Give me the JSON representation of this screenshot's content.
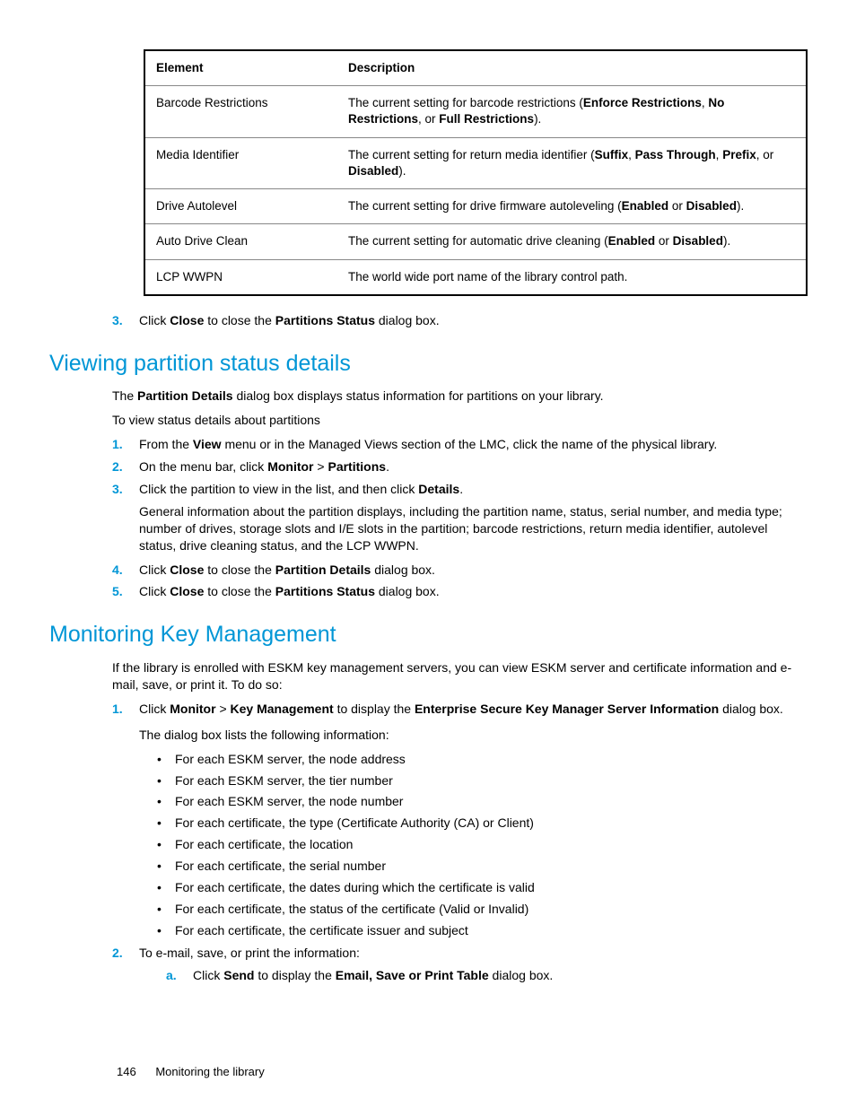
{
  "table": {
    "headers": [
      "Element",
      "Description"
    ],
    "rows": [
      {
        "element": "Barcode Restrictions",
        "desc_pre": "The current setting for barcode restrictions (",
        "desc_b1": "Enforce Restrictions",
        "desc_mid1": ", ",
        "desc_b2": "No Restrictions",
        "desc_mid2": ", or ",
        "desc_b3": "Full Restrictions",
        "desc_post": ")."
      },
      {
        "element": "Media Identifier",
        "desc_pre": "The current setting for return media identifier (",
        "desc_b1": "Suffix",
        "desc_mid1": ", ",
        "desc_b2": "Pass Through",
        "desc_mid2": ", ",
        "desc_b3": "Prefix",
        "desc_mid3": ", or ",
        "desc_b4": "Disabled",
        "desc_post": ")."
      },
      {
        "element": "Drive Autolevel",
        "desc_pre": "The current setting for drive firmware autoleveling (",
        "desc_b1": "Enabled",
        "desc_mid1": " or ",
        "desc_b2": "Disabled",
        "desc_post": ")."
      },
      {
        "element": "Auto Drive Clean",
        "desc_pre": "The current setting for automatic drive cleaning (",
        "desc_b1": "Enabled",
        "desc_mid1": " or ",
        "desc_b2": "Disabled",
        "desc_post": ")."
      },
      {
        "element": "LCP WWPN",
        "desc_plain": "The world wide port name of the library control path."
      }
    ]
  },
  "step3_top": {
    "marker": "3.",
    "t1": "Click ",
    "b1": "Close",
    "t2": " to close the ",
    "b2": "Partitions Status",
    "t3": " dialog box."
  },
  "section1": {
    "title": "Viewing partition status details",
    "p1_t1": "The ",
    "p1_b1": "Partition Details",
    "p1_t2": " dialog box displays status information for partitions on your library.",
    "p2": "To view status details about partitions",
    "steps": [
      {
        "marker": "1.",
        "t1": "From the ",
        "b1": "View",
        "t2": " menu or in the Managed Views section of the LMC, click the name of the physical library."
      },
      {
        "marker": "2.",
        "t1": "On the menu bar, click ",
        "b1": "Monitor",
        "t2": " > ",
        "b2": "Partitions",
        "t3": "."
      },
      {
        "marker": "3.",
        "t1": "Click the partition to view in the list, and then click ",
        "b1": "Details",
        "t2": ".",
        "extra": "General information about the partition displays, including the partition name, status, serial number, and media type; number of drives, storage slots and I/E slots in the partition; barcode restrictions, return media identifier, autolevel status, drive cleaning status, and the LCP WWPN."
      },
      {
        "marker": "4.",
        "t1": "Click ",
        "b1": "Close",
        "t2": " to close the ",
        "b2": "Partition Details",
        "t3": " dialog box."
      },
      {
        "marker": "5.",
        "t1": "Click ",
        "b1": "Close",
        "t2": " to close the ",
        "b2": "Partitions Status",
        "t3": " dialog box."
      }
    ]
  },
  "section2": {
    "title": "Monitoring Key Management",
    "p1": "If the library is enrolled with ESKM key management servers, you can view ESKM server and certificate information and e-mail, save, or print it. To do so:",
    "step1": {
      "marker": "1.",
      "t1": "Click ",
      "b1": "Monitor",
      "t2": " > ",
      "b2": "Key Management",
      "t3": " to display the ",
      "b3": "Enterprise Secure Key Manager Server Information",
      "t4": " dialog box."
    },
    "step1_p2": "The dialog box lists the following information:",
    "bullets": [
      "For each ESKM server, the node address",
      "For each ESKM server, the tier number",
      "For each ESKM server, the node number",
      "For each certificate, the type (Certificate Authority (CA) or Client)",
      "For each certificate, the location",
      "For each certificate, the serial number",
      "For each certificate, the dates during which the certificate is valid",
      "For each certificate, the status of the certificate (Valid or Invalid)",
      "For each certificate, the certificate issuer and subject"
    ],
    "step2": {
      "marker": "2.",
      "t1": "To e-mail, save, or print the information:"
    },
    "step2a": {
      "marker": "a.",
      "t1": "Click ",
      "b1": "Send",
      "t2": " to display the ",
      "b2": "Email, Save or Print Table",
      "t3": " dialog box."
    }
  },
  "footer": {
    "page": "146",
    "title": "Monitoring the library"
  }
}
